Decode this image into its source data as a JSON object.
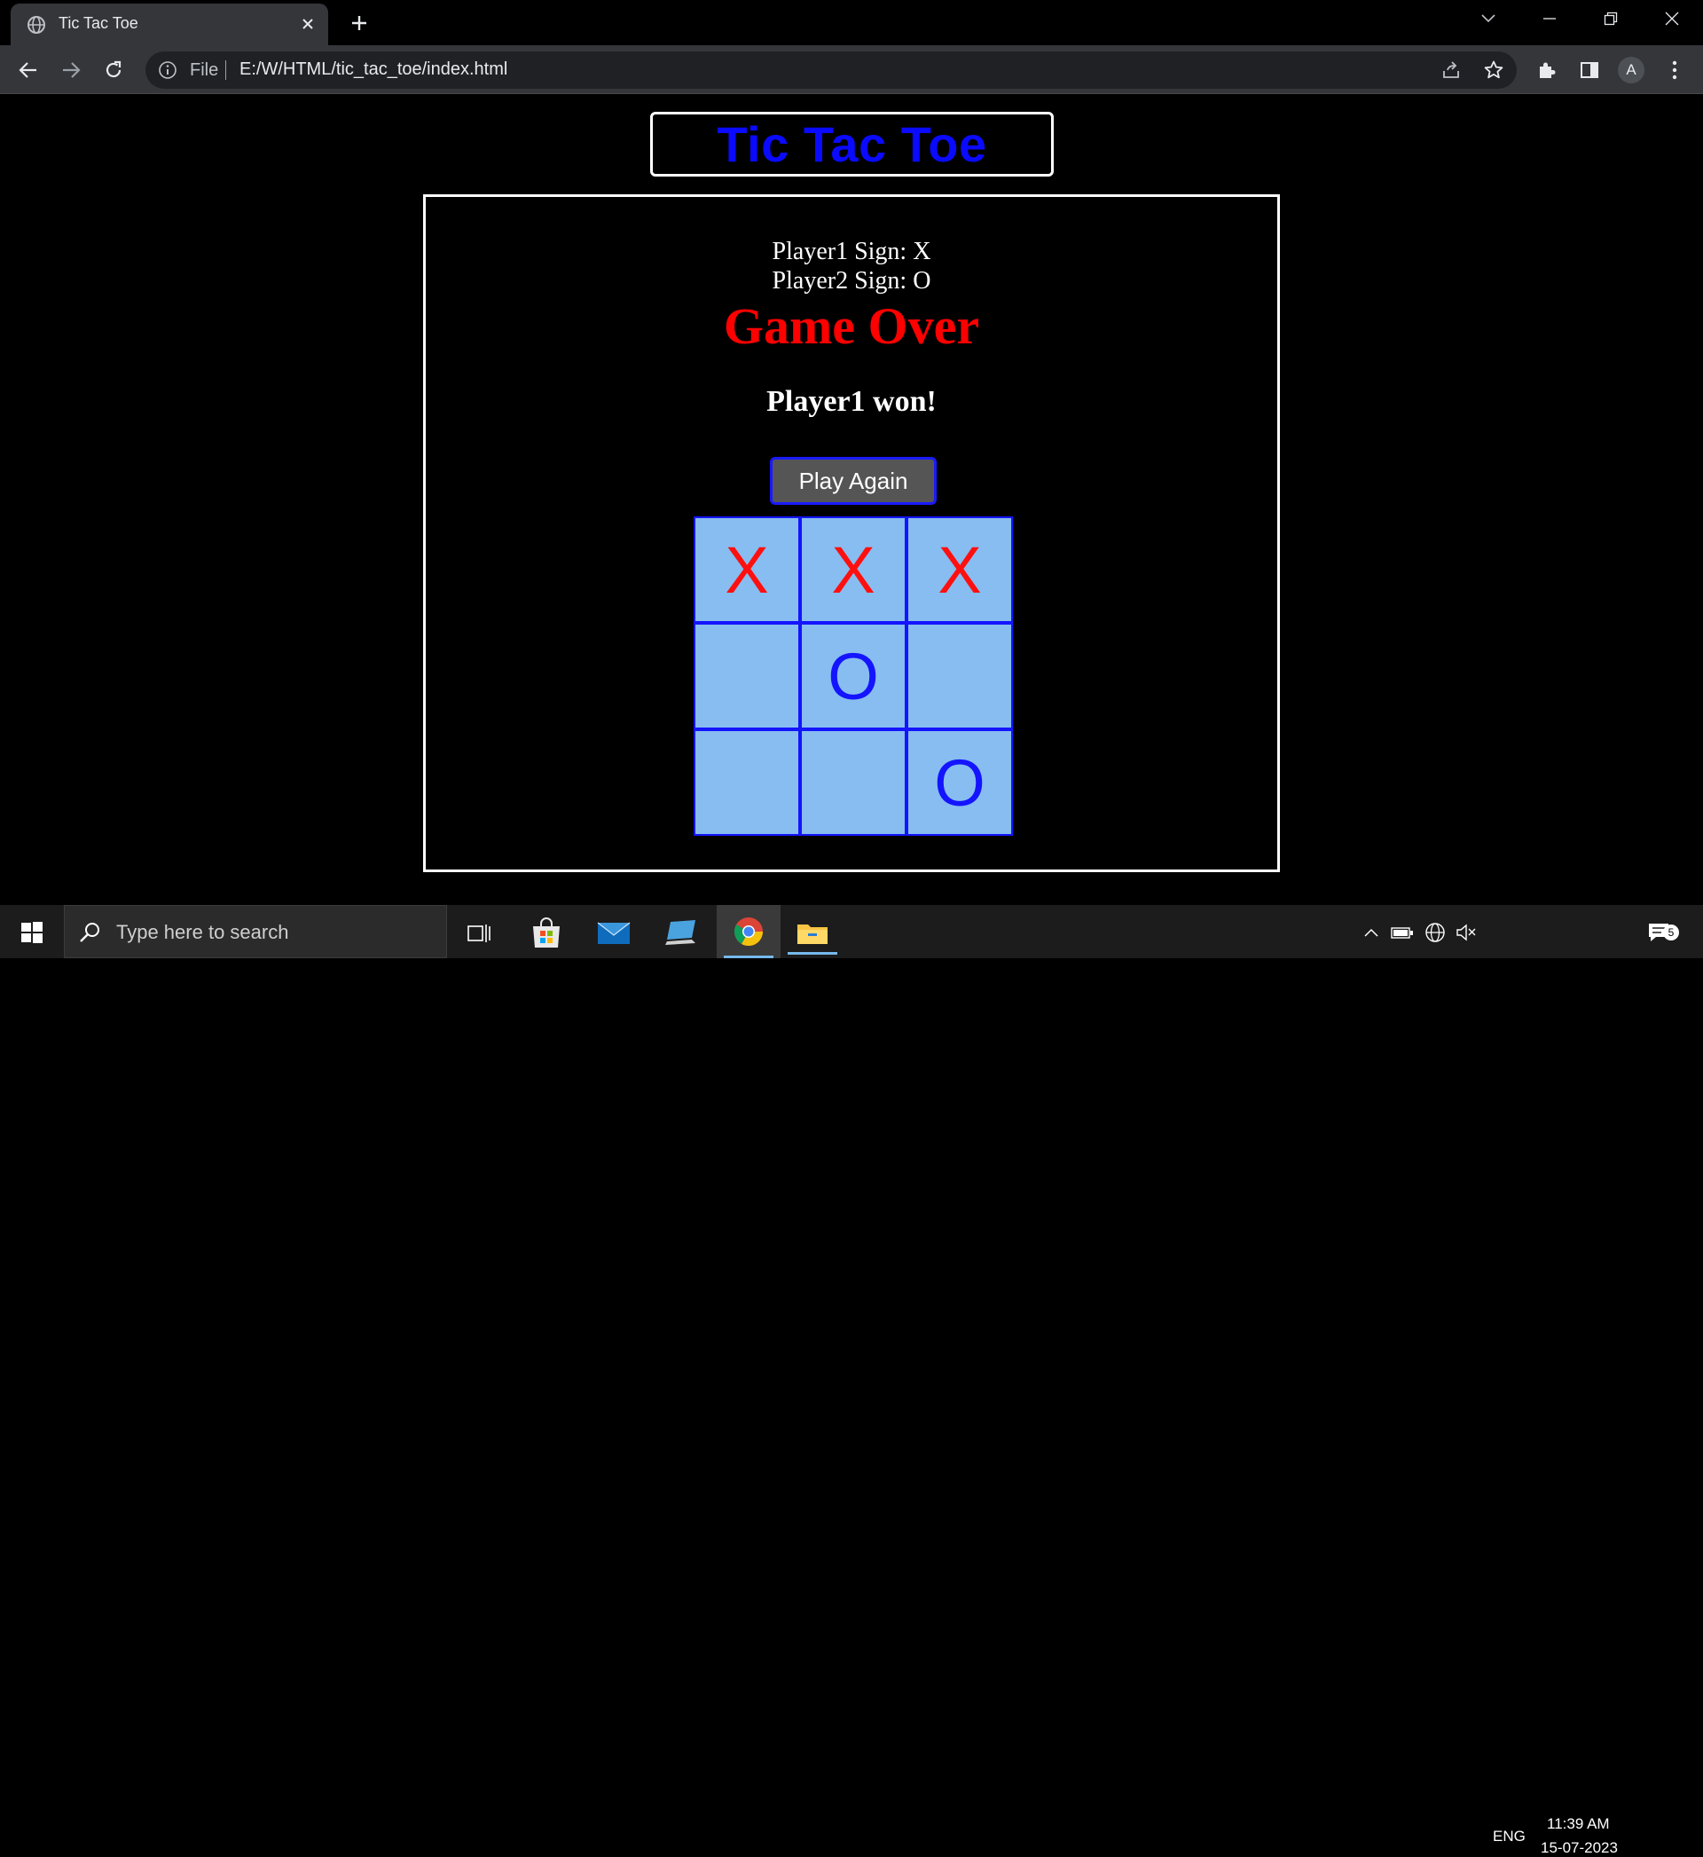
{
  "browser": {
    "tab_title": "Tic Tac Toe",
    "address": {
      "scheme_label": "File",
      "url": "E:/W/HTML/tic_tac_toe/index.html"
    },
    "profile_initial": "A"
  },
  "page": {
    "title": "Tic Tac Toe",
    "player1_sign": "Player1 Sign: X",
    "player2_sign": "Player2 Sign: O",
    "status": "Game Over",
    "result": "Player1 won!",
    "play_again_label": "Play Again",
    "board": [
      [
        "X",
        "X",
        "X"
      ],
      [
        "",
        "O",
        ""
      ],
      [
        "",
        "",
        "O"
      ]
    ],
    "colors": {
      "title": "#0a0aff",
      "status": "#ff0000",
      "x_mark": "#ff1010",
      "o_mark": "#1414ff",
      "cell_bg": "#87bdf0",
      "grid_line": "#1414ff"
    }
  },
  "taskbar": {
    "search_placeholder": "Type here to search",
    "language": "ENG",
    "time": "11:39 AM",
    "date": "15-07-2023",
    "notification_count": "5"
  }
}
